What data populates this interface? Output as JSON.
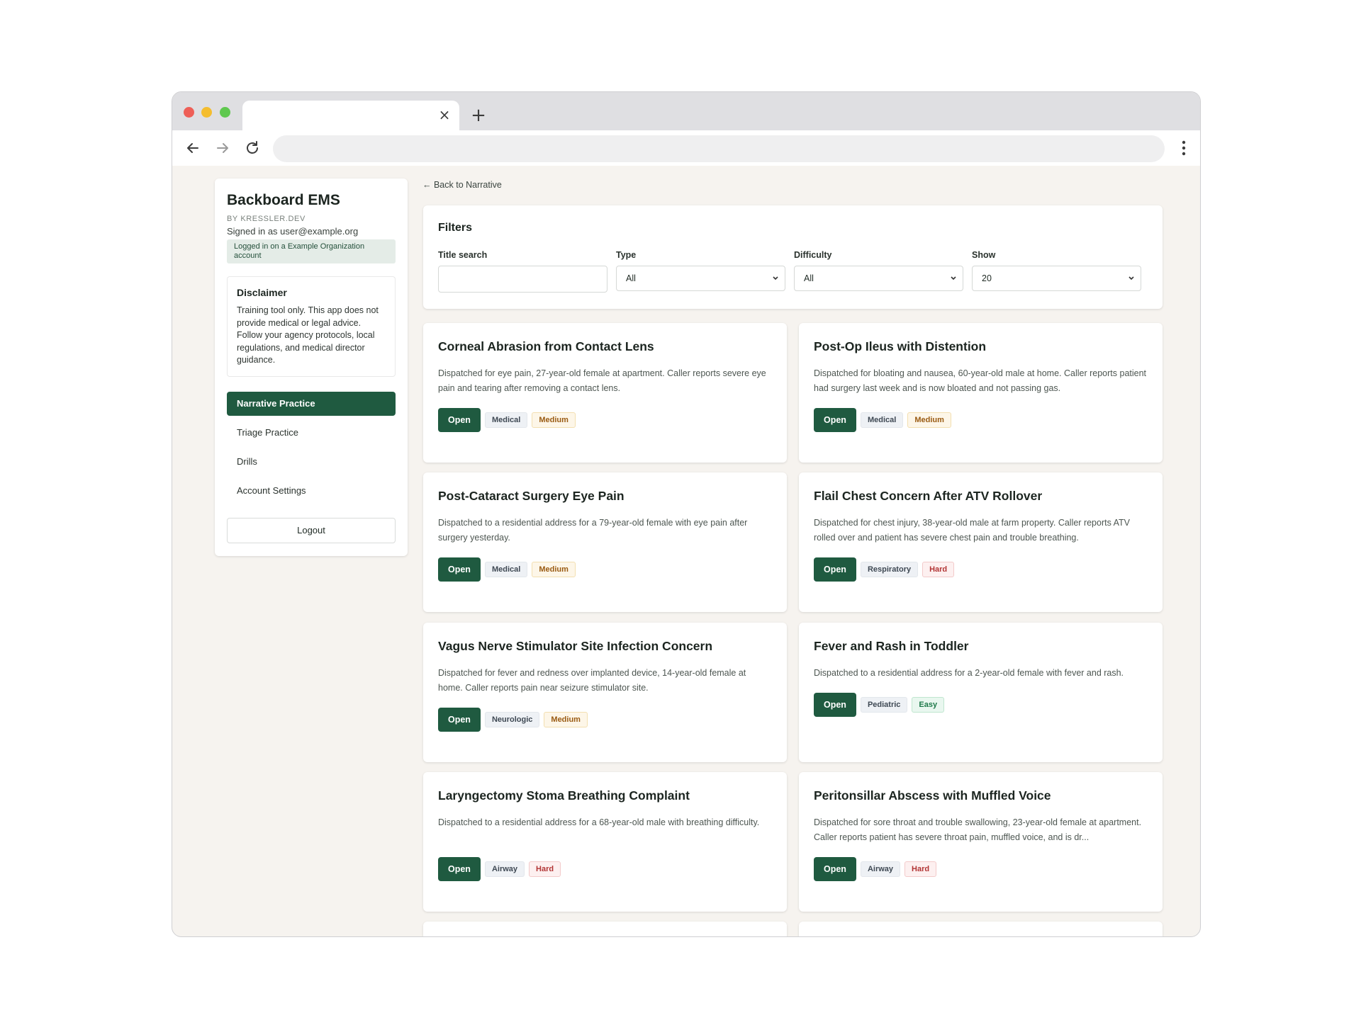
{
  "browser": {
    "tab_close_icon": "×",
    "new_tab_icon": "+"
  },
  "sidebar": {
    "brand": "Backboard EMS",
    "brand_sub": "BY KRESSLER.DEV",
    "signed_in": "Signed in as user@example.org",
    "org_badge": "Logged in on a Example Organization account",
    "disclaimer": {
      "title": "Disclaimer",
      "body": "Training tool only. This app does not provide medical or legal advice. Follow your agency protocols, local regulations, and medical director guidance."
    },
    "nav": [
      {
        "label": "Narrative Practice",
        "active": true
      },
      {
        "label": "Triage Practice",
        "active": false
      },
      {
        "label": "Drills",
        "active": false
      },
      {
        "label": "Account Settings",
        "active": false
      }
    ],
    "logout": "Logout"
  },
  "main": {
    "back_link": "← Back to Narrative",
    "filters": {
      "title": "Filters",
      "title_search_label": "Title search",
      "title_search_value": "",
      "type_label": "Type",
      "type_value": "All",
      "difficulty_label": "Difficulty",
      "difficulty_value": "All",
      "show_label": "Show",
      "show_value": "20"
    },
    "open_label": "Open",
    "cards": [
      {
        "title": "Corneal Abrasion from Contact Lens",
        "description": "Dispatched for eye pain, 27-year-old female at apartment. Caller reports severe eye pain and tearing after removing a contact lens.",
        "category": "Medical",
        "difficulty": "Medium"
      },
      {
        "title": "Post-Op Ileus with Distention",
        "description": "Dispatched for bloating and nausea, 60-year-old male at home. Caller reports patient had surgery last week and is now bloated and not passing gas.",
        "category": "Medical",
        "difficulty": "Medium"
      },
      {
        "title": "Post-Cataract Surgery Eye Pain",
        "description": "Dispatched to a residential address for a 79-year-old female with eye pain after surgery yesterday.",
        "category": "Medical",
        "difficulty": "Medium"
      },
      {
        "title": "Flail Chest Concern After ATV Rollover",
        "description": "Dispatched for chest injury, 38-year-old male at farm property. Caller reports ATV rolled over and patient has severe chest pain and trouble breathing.",
        "category": "Respiratory",
        "difficulty": "Hard"
      },
      {
        "title": "Vagus Nerve Stimulator Site Infection Concern",
        "description": "Dispatched for fever and redness over implanted device, 14-year-old female at home. Caller reports pain near seizure stimulator site.",
        "category": "Neurologic",
        "difficulty": "Medium"
      },
      {
        "title": "Fever and Rash in Toddler",
        "description": "Dispatched to a residential address for a 2-year-old female with fever and rash.",
        "category": "Pediatric",
        "difficulty": "Easy"
      },
      {
        "title": "Laryngectomy Stoma Breathing Complaint",
        "description": "Dispatched to a residential address for a 68-year-old male with breathing difficulty.",
        "category": "Airway",
        "difficulty": "Hard"
      },
      {
        "title": "Peritonsillar Abscess with Muffled Voice",
        "description": "Dispatched for sore throat and trouble swallowing, 23-year-old female at apartment. Caller reports patient has severe throat pain, muffled voice, and is dr...",
        "category": "Airway",
        "difficulty": "Hard"
      }
    ]
  },
  "colors": {
    "accent": "#1f5a40",
    "page_bg": "#f6f3ef"
  }
}
